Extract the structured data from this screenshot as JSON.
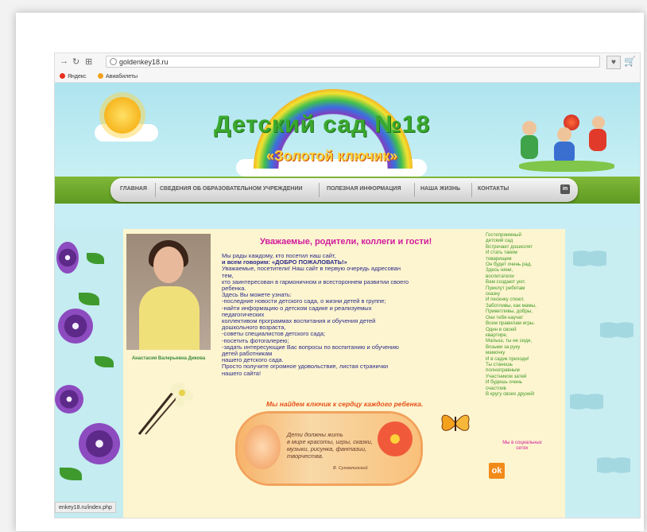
{
  "browser": {
    "url": "goldenkey18.ru",
    "bookmarks": [
      "Яндекс",
      "Авиабилеты"
    ],
    "status_url": "enkey18.ru/index.php"
  },
  "header": {
    "title_line1": "Детский сад №18",
    "title_line2": "«Золотой ключик»"
  },
  "menu": {
    "items": [
      "ГЛАВНАЯ",
      "СВЕДЕНИЯ ОБ ОБРАЗОВАТЕЛЬНОМ УЧРЕЖДЕНИИ",
      "ПОЛЕЗНАЯ ИНФОРМАЦИЯ",
      "НАША ЖИЗНЬ",
      "КОНТАКТЫ"
    ],
    "social": "in"
  },
  "main": {
    "photo_caption": "Анастасия Валерьевна Дикова",
    "welcome": "Уважаемые, родители, коллеги и гости!",
    "body_lines": [
      "Мы рады каждому, кто посетил наш сайт,",
      "и всем говорим:  «ДОБРО ПОЖАЛОВАТЬ!»",
      "Уважаемые, посетители! Наш сайт в первую очередь адресован",
      "тем,",
      "кто заинтересован в гармоничном и всестороннем развитии своего",
      "ребенка.",
      "Здесь Вы можете узнать:",
      "-последние новости детского сада, о жизни детей в группе;",
      "-найти информацию о детском садике и реализуемых",
      "педагогических",
      "коллективом программах воспитания и обучения детей",
      "дошкольного  возраста,",
      "-советы специалистов детского сада;",
      "-посетить фотогалерею;",
      "-задать интересующие Вас вопросы по воспитанию и обучению",
      "детей работникам",
      "нашего детского сада.",
      "Просто получите огромное удовольствие, листая странички",
      "нашего сайта!"
    ],
    "slogan": "Мы найдем ключик к сердцу каждого ребенка.",
    "quote_lines": [
      "Дети должны жить",
      "в мире красоты, игры, сказки,",
      "музыки, рисунка, фантазии,",
      "творчества."
    ],
    "quote_author": "В. Сухомлинский"
  },
  "poem": {
    "lines": [
      "Гостеприимный",
      "детский сад",
      "Встречает дошколят",
      "И стать таким",
      "товарищем",
      "Он будет очень рад.",
      "Здесь няни,",
      "воспитатели",
      "Вам создают уют.",
      "Приклут ребятам",
      "сказку",
      "И песенку споют.",
      "Заботливы, как мамы,",
      "Приветливы, добры,",
      "Они тебя научат",
      "Всем правилам игры.",
      "Один в своей",
      "квартире,",
      "Малыш, ты не сиди,",
      "Возьми за руку",
      "мамочку",
      "И в садик приходи!",
      "Ты станешь",
      "полноправным",
      "Участником затей",
      "И будешь очень",
      "счастлив",
      "В кругу своих друзей!"
    ],
    "social_label_1": "Мы в социальных",
    "social_label_2": "сетях"
  }
}
